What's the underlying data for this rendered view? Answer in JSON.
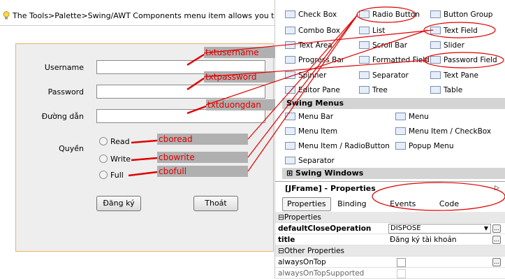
{
  "tip": {
    "text": "The Tools>Palette>Swing/AWT Components menu item allows you to modify the c"
  },
  "form": {
    "username_label": "Username",
    "password_label": "Password",
    "path_label": "Đường dẫn",
    "quyen_label": "Quyền",
    "radios": [
      "Read",
      "Write",
      "Full"
    ],
    "register_button": "Đăng ký",
    "exit_button": "Thoát"
  },
  "annotations": {
    "txtusername": "txtusername",
    "txtpassword": "txtpassword",
    "txtduongdan": "txtduongdan",
    "cboread": "cboread",
    "cbowrite": "cbowrite",
    "cbofull": "cbofull"
  },
  "palette": {
    "components": [
      [
        "Check Box",
        "Radio Button",
        "Button Group"
      ],
      [
        "Combo Box",
        "List",
        "Text Field"
      ],
      [
        "Text Area",
        "Scroll Bar",
        "Slider"
      ],
      [
        "Progress Bar",
        "Formatted Field",
        "Password Field"
      ],
      [
        "Spinner",
        "Separator",
        "Text Pane"
      ],
      [
        "Editor Pane",
        "Tree",
        "Table"
      ]
    ],
    "menus_category": "Swing Menus",
    "menus": [
      [
        "Menu Bar",
        "Menu"
      ],
      [
        "Menu Item",
        "Menu Item / CheckBox"
      ],
      [
        "Menu Item / RadioButton",
        "Popup Menu"
      ],
      [
        "Separator",
        ""
      ]
    ],
    "windows_category": "Swing Windows"
  },
  "properties": {
    "title": "[JFrame] - Properties",
    "tabs": [
      "Properties",
      "Binding",
      "Events",
      "Code"
    ],
    "section_properties": "Properties",
    "rows": [
      {
        "name": "defaultCloseOperation",
        "value": "DISPOSE"
      },
      {
        "name": "title",
        "value": "Đăng ký tài khoản"
      }
    ],
    "section_other": "Other Properties",
    "other_rows": [
      {
        "name": "alwaysOnTop"
      },
      {
        "name": "alwaysOnTopSupported"
      }
    ]
  },
  "colors": {
    "annotation_text": "#e00000",
    "annotation_bg": "#b0b0b0",
    "form_border": "#f0b060"
  }
}
